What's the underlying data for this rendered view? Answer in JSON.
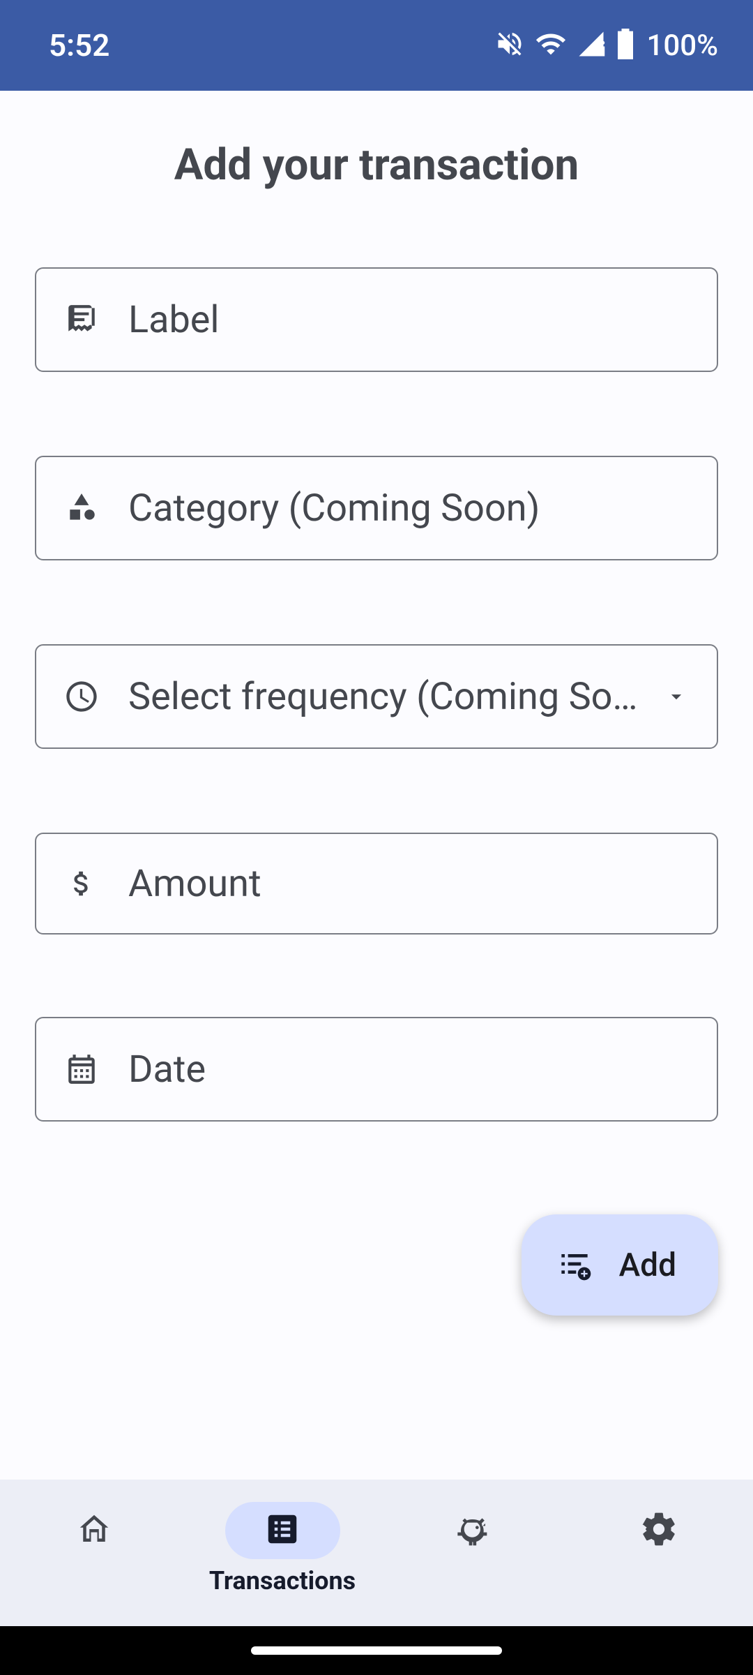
{
  "status": {
    "time": "5:52",
    "battery": "100%"
  },
  "page": {
    "title": "Add your transaction"
  },
  "fields": {
    "label": {
      "placeholder": "Label"
    },
    "category": {
      "placeholder": "Category (Coming Soon)"
    },
    "frequency": {
      "placeholder": "Select frequency (Coming So…"
    },
    "amount": {
      "placeholder": "Amount"
    },
    "date": {
      "placeholder": "Date"
    }
  },
  "fab": {
    "label": "Add"
  },
  "nav": {
    "home": "",
    "transactions": "Transactions",
    "savings": "",
    "settings": ""
  }
}
